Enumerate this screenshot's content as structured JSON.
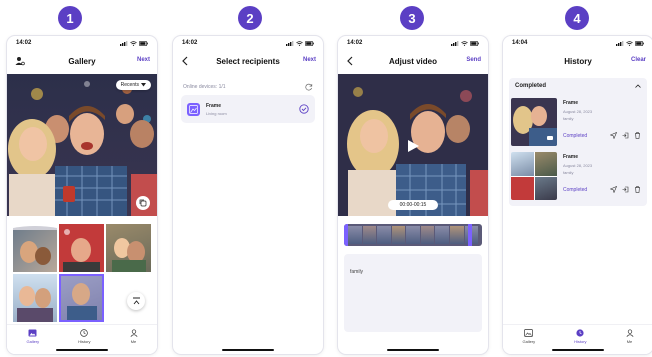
{
  "steps": [
    "1",
    "2",
    "3",
    "4"
  ],
  "colors": {
    "accent": "#5b3fc4",
    "accent_light": "#ece8fb",
    "card_bg": "#f2f2f8"
  },
  "screen1": {
    "time": "14:02",
    "title": "Gallery",
    "next": "Next",
    "dropdown": "Recents",
    "tabs": [
      "Gallery",
      "History",
      "Me"
    ]
  },
  "screen2": {
    "time": "14:02",
    "title": "Select recipients",
    "next": "Next",
    "online_label": "Online devices: 1/1",
    "device_name": "Frame",
    "device_location": "Living room"
  },
  "screen3": {
    "time": "14:02",
    "title": "Adjust video",
    "send": "Send",
    "timecode": "00:00-00:15",
    "caption": "family"
  },
  "screen4": {
    "time": "14:04",
    "title": "History",
    "clear": "Clear",
    "section": "Completed",
    "items": [
      {
        "name": "Frame",
        "date": "August 28, 2023",
        "caption": "family",
        "status": "Completed"
      },
      {
        "name": "Frame",
        "date": "August 28, 2023",
        "caption": "family",
        "status": "Completed"
      }
    ],
    "tabs": [
      "Gallery",
      "History",
      "Me"
    ]
  }
}
